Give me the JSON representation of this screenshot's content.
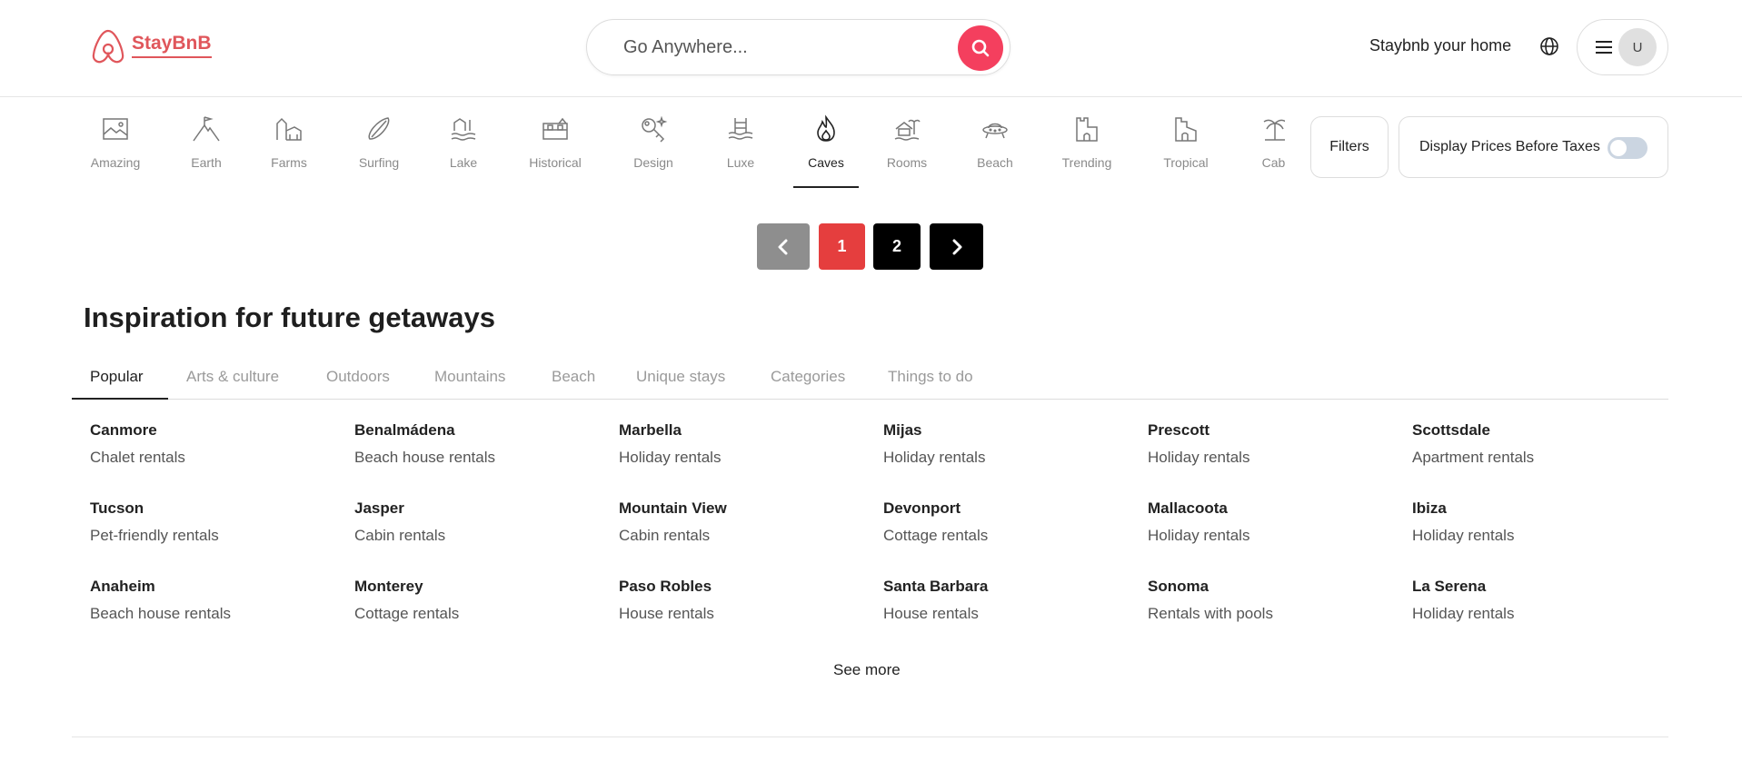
{
  "header": {
    "logo_text": "StayBnB",
    "search_placeholder": "Go Anywhere...",
    "host_link": "Staybnb your home",
    "avatar_initial": "U",
    "accent_color": "#f43f5e",
    "logo_color": "#e0565b"
  },
  "categories": [
    {
      "label": "Amazing",
      "icon": "photo-frame-icon"
    },
    {
      "label": "Earth",
      "icon": "mountain-flag-icon"
    },
    {
      "label": "Farms",
      "icon": "barn-icon"
    },
    {
      "label": "Surfing",
      "icon": "surfboard-icon"
    },
    {
      "label": "Lake",
      "icon": "lake-house-icon"
    },
    {
      "label": "Historical",
      "icon": "historic-building-icon"
    },
    {
      "label": "Design",
      "icon": "magic-key-icon"
    },
    {
      "label": "Luxe",
      "icon": "pool-icon"
    },
    {
      "label": "Caves",
      "icon": "fire-icon",
      "active": true
    },
    {
      "label": "Rooms",
      "icon": "bungalow-icon"
    },
    {
      "label": "Beach",
      "icon": "ufo-icon"
    },
    {
      "label": "Trending",
      "icon": "castle-icon"
    },
    {
      "label": "Tropical",
      "icon": "tower-icon"
    },
    {
      "label": "Cabi",
      "icon": "palm-tree-icon"
    }
  ],
  "filters": {
    "filters_label": "Filters",
    "taxes_label": "Display Prices Before Taxes",
    "taxes_toggle_on": false
  },
  "pagination": {
    "prev_icon": "chevron-left-icon",
    "pages": [
      "1",
      "2"
    ],
    "current_page": "1",
    "next_icon": "chevron-right-icon"
  },
  "inspiration": {
    "title": "Inspiration for future getaways",
    "tabs": [
      "Popular",
      "Arts & culture",
      "Outdoors",
      "Mountains",
      "Beach",
      "Unique stays",
      "Categories",
      "Things to do"
    ],
    "active_tab": "Popular",
    "destinations": [
      {
        "city": "Canmore",
        "type": "Chalet rentals"
      },
      {
        "city": "Benalmádena",
        "type": "Beach house rentals"
      },
      {
        "city": "Marbella",
        "type": "Holiday rentals"
      },
      {
        "city": "Mijas",
        "type": "Holiday rentals"
      },
      {
        "city": "Prescott",
        "type": "Holiday rentals"
      },
      {
        "city": "Scottsdale",
        "type": "Apartment rentals"
      },
      {
        "city": "Tucson",
        "type": "Pet-friendly rentals"
      },
      {
        "city": "Jasper",
        "type": "Cabin rentals"
      },
      {
        "city": "Mountain View",
        "type": "Cabin rentals"
      },
      {
        "city": "Devonport",
        "type": "Cottage rentals"
      },
      {
        "city": "Mallacoota",
        "type": "Holiday rentals"
      },
      {
        "city": "Ibiza",
        "type": "Holiday rentals"
      },
      {
        "city": "Anaheim",
        "type": "Beach house rentals"
      },
      {
        "city": "Monterey",
        "type": "Cottage rentals"
      },
      {
        "city": "Paso Robles",
        "type": "House rentals"
      },
      {
        "city": "Santa Barbara",
        "type": "House rentals"
      },
      {
        "city": "Sonoma",
        "type": "Rentals with pools"
      },
      {
        "city": "La Serena",
        "type": "Holiday rentals"
      }
    ],
    "see_more": "See more"
  }
}
